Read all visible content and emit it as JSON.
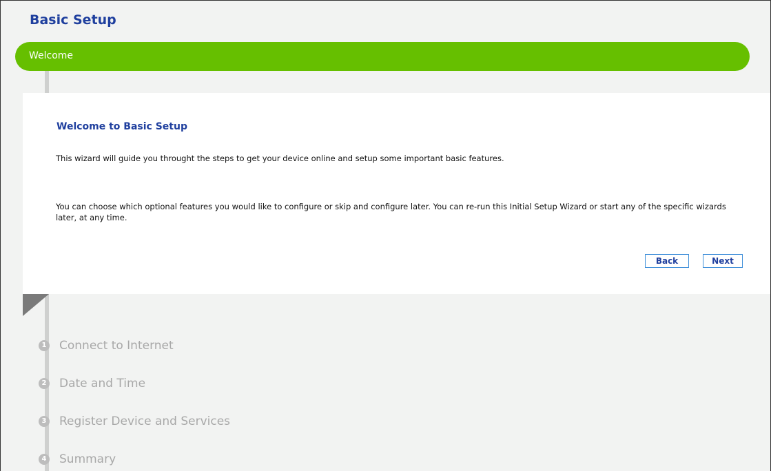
{
  "page": {
    "title": "Basic Setup"
  },
  "stage": {
    "label": "Welcome"
  },
  "card": {
    "heading": "Welcome to Basic Setup",
    "paragraph1": "This wizard will guide you throught the steps to get your device online and setup some important basic features.",
    "paragraph2": "You can choose which optional features you would like to configure or skip and configure later. You can re-run this Initial Setup Wizard or start any of the specific wizards later, at any time.",
    "back_label": "Back",
    "next_label": "Next"
  },
  "steps": [
    {
      "number": "1",
      "label": "Connect to Internet"
    },
    {
      "number": "2",
      "label": "Date and Time"
    },
    {
      "number": "3",
      "label": "Register Device and Services"
    },
    {
      "number": "4",
      "label": "Summary"
    }
  ],
  "colors": {
    "accent_green": "#66bf00",
    "title_blue": "#1f3f9e",
    "button_border": "#3f8fd9",
    "inactive_step": "#a8a8a8"
  }
}
